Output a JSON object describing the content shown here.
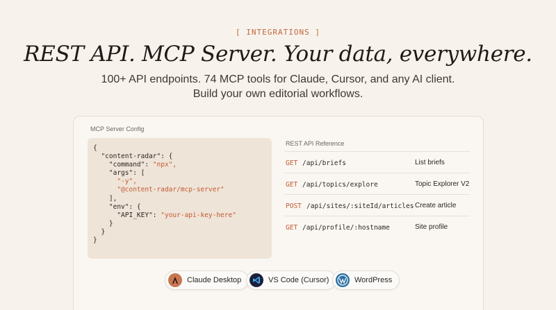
{
  "eyebrow": "[ INTEGRATIONS ]",
  "headline": "REST API. MCP Server. Your data, everywhere.",
  "subtitle_line1": "100+ API endpoints. 74 MCP tools for Claude, Cursor, and any AI client.",
  "subtitle_line2": "Build your own editorial workflows.",
  "mcp_config": {
    "label": "MCP Server Config",
    "code": {
      "open": "{",
      "key_radar": "\"content-radar\": {",
      "command_key": "\"command\": ",
      "command_val": "\"npx\",",
      "args_key": "\"args\": [",
      "arg1": "\"-y\",",
      "arg2": "\"@content-radar/mcp-server\"",
      "args_close": "],",
      "env_key": "\"env\": {",
      "api_key_key": "\"API_KEY\": ",
      "api_key_val": "\"your-api-key-here\"",
      "env_close": "}",
      "radar_close": "}",
      "close": "}"
    }
  },
  "rest_reference": {
    "label": "REST API Reference",
    "endpoints": [
      {
        "method": "GET",
        "path": "/api/briefs",
        "description": "List briefs"
      },
      {
        "method": "GET",
        "path": "/api/topics/explore",
        "description": "Topic Explorer V2"
      },
      {
        "method": "POST",
        "path": "/api/sites/:siteId/articles",
        "description": "Create article"
      },
      {
        "method": "GET",
        "path": "/api/profile/:hostname",
        "description": "Site profile"
      }
    ]
  },
  "clients": [
    {
      "label": "Claude Desktop",
      "icon": "claude-icon"
    },
    {
      "label": "VS Code (Cursor)",
      "icon": "vscode-icon"
    },
    {
      "label": "WordPress",
      "icon": "wordpress-icon"
    }
  ],
  "colors": {
    "background": "#f7f3ec",
    "accent": "#c25a34",
    "code_bg": "#efe4d8"
  }
}
